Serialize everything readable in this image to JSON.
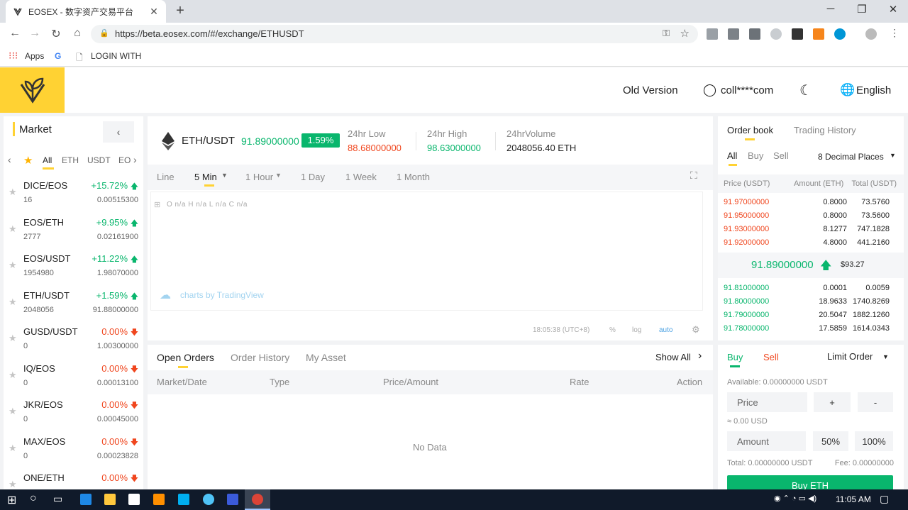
{
  "browser": {
    "tab_title": "EOSEX - 数字资产交易平台",
    "url": "https://beta.eosex.com/#/exchange/ETHUSDT",
    "bookmarks": {
      "apps": "Apps",
      "login": "LOGIN WITH"
    }
  },
  "header": {
    "old_version": "Old Version",
    "user": "coll****com",
    "language": "English"
  },
  "market": {
    "title": "Market",
    "tabs": [
      "All",
      "ETH",
      "USDT",
      "EO"
    ],
    "rows": [
      {
        "pair": "DICE/EOS",
        "change": "+15.72%",
        "dir": "up",
        "volume": "16",
        "price": "0.00515300"
      },
      {
        "pair": "EOS/ETH",
        "change": "+9.95%",
        "dir": "up",
        "volume": "2777",
        "price": "0.02161900"
      },
      {
        "pair": "EOS/USDT",
        "change": "+11.22%",
        "dir": "up",
        "volume": "1954980",
        "price": "1.98070000"
      },
      {
        "pair": "ETH/USDT",
        "change": "+1.59%",
        "dir": "up",
        "volume": "2048056",
        "price": "91.88000000"
      },
      {
        "pair": "GUSD/USDT",
        "change": "0.00%",
        "dir": "down",
        "volume": "0",
        "price": "1.00300000"
      },
      {
        "pair": "IQ/EOS",
        "change": "0.00%",
        "dir": "down",
        "volume": "0",
        "price": "0.00013100"
      },
      {
        "pair": "JKR/EOS",
        "change": "0.00%",
        "dir": "down",
        "volume": "0",
        "price": "0.00045000"
      },
      {
        "pair": "MAX/EOS",
        "change": "0.00%",
        "dir": "down",
        "volume": "0",
        "price": "0.00023828"
      },
      {
        "pair": "ONE/ETH",
        "change": "0.00%",
        "dir": "down",
        "volume": "",
        "price": ""
      }
    ]
  },
  "ticker": {
    "pair": "ETH/USDT",
    "price": "91.89000000",
    "change": "1.59%",
    "low_label": "24hr Low",
    "low": "88.68000000",
    "high_label": "24hr High",
    "high": "98.63000000",
    "vol_label": "24hrVolume",
    "volume": "2048056.40 ETH"
  },
  "chart": {
    "intervals": [
      "Line",
      "5 Min",
      "1 Hour",
      "1 Day",
      "1 Week",
      "1 Month"
    ],
    "ohlc": "O n/a H n/a L n/a C n/a",
    "credit": "charts by TradingView",
    "time": "18:05:38 (UTC+8)",
    "pct": "%",
    "log": "log",
    "auto": "auto"
  },
  "orders": {
    "tabs": [
      "Open Orders",
      "Order History",
      "My Asset"
    ],
    "show_all": "Show All",
    "columns": [
      "Market/Date",
      "Type",
      "Price/Amount",
      "Rate",
      "Action"
    ],
    "empty": "No Data"
  },
  "orderbook": {
    "tabs": [
      "Order book",
      "Trading History"
    ],
    "filters": [
      "All",
      "Buy",
      "Sell"
    ],
    "decimals": "8 Decimal Places",
    "headers": [
      "Price (USDT)",
      "Amount (ETH)",
      "Total (USDT)"
    ],
    "asks": [
      [
        "91.97000000",
        "0.8000",
        "73.5760"
      ],
      [
        "91.95000000",
        "0.8000",
        "73.5600"
      ],
      [
        "91.93000000",
        "8.1277",
        "747.1828"
      ],
      [
        "91.92000000",
        "4.8000",
        "441.2160"
      ]
    ],
    "last_price": "91.89000000",
    "last_usd": "$93.27",
    "bids": [
      [
        "91.81000000",
        "0.0001",
        "0.0059"
      ],
      [
        "91.80000000",
        "18.9633",
        "1740.8269"
      ],
      [
        "91.79000000",
        "20.5047",
        "1882.1260"
      ],
      [
        "91.78000000",
        "17.5859",
        "1614.0343"
      ]
    ]
  },
  "trade": {
    "buy": "Buy",
    "sell": "Sell",
    "order_type": "Limit Order",
    "available": "Available: 0.00000000 USDT",
    "price_ph": "Price",
    "plus": "+",
    "minus": "-",
    "approx": "≈ 0.00 USD",
    "amount_ph": "Amount",
    "p50": "50%",
    "p100": "100%",
    "total": "Total: 0.00000000 USDT",
    "fee": "Fee: 0.00000000",
    "submit": "Buy ETH"
  },
  "taskbar": {
    "time": "11:05 AM"
  },
  "colors": {
    "brand": "#ffd233",
    "up": "#09b66d",
    "down": "#f0461e"
  }
}
